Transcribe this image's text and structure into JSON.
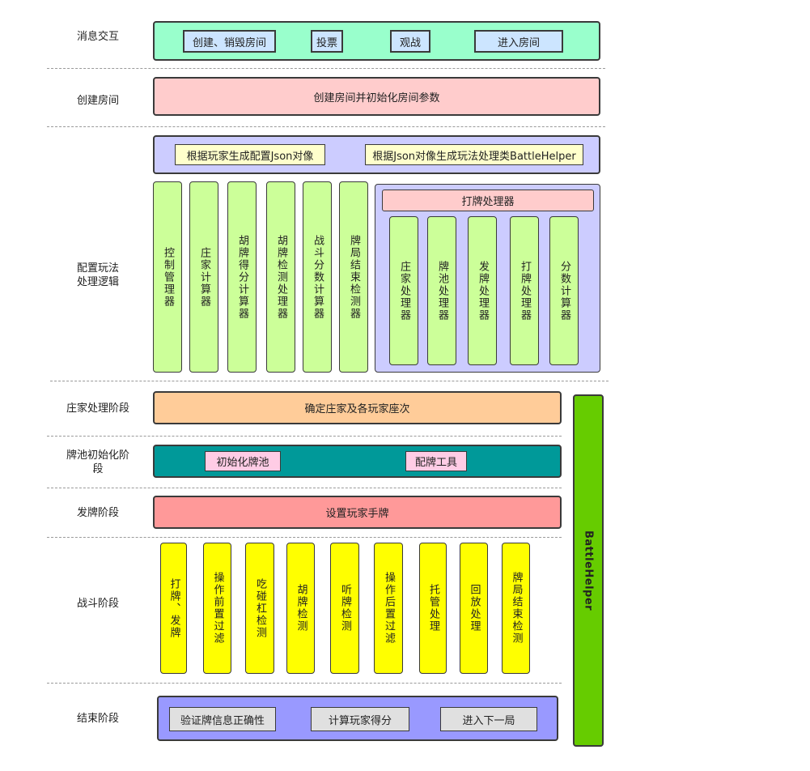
{
  "labels": {
    "message": "消息交互",
    "create_room": "创建房间",
    "config": "配置玩法\n处理逻辑",
    "dealer": "庄家处理阶段",
    "pool": "牌池初始化阶\n段",
    "deal": "发牌阶段",
    "battle": "战斗阶段",
    "end": "结束阶段"
  },
  "message": {
    "items": [
      "创建、销毁房间",
      "投票",
      "观战",
      "进入房间"
    ]
  },
  "create_room": {
    "text": "创建房间并初始化房间参数"
  },
  "config": {
    "top_items": [
      "根据玩家生成配置Json对像",
      "根据Json对像生成玩法处理类BattleHelper"
    ],
    "columns": [
      "控制管理器",
      "庄家计算器",
      "胡牌得分计算器",
      "胡牌检测处理器",
      "战斗分数计算器",
      "牌局结束检测器"
    ],
    "play_handler": {
      "title": "打牌处理器",
      "columns": [
        "庄家处理器",
        "牌池处理器",
        "发牌处理器",
        "打牌处理器",
        "分数计算器"
      ]
    }
  },
  "dealer": {
    "text": "确定庄家及各玩家座次"
  },
  "pool": {
    "items": [
      "初始化牌池",
      "配牌工具"
    ]
  },
  "deal": {
    "text": "设置玩家手牌"
  },
  "battle": {
    "columns": [
      "打牌、发牌",
      "操作前置过滤",
      "吃碰杠检测",
      "胡牌检测",
      "听牌检测",
      "操作后置过滤",
      "托管处理",
      "回放处理",
      "牌局结束检测"
    ]
  },
  "end": {
    "items": [
      "验证牌信息正确性",
      "计算玩家得分",
      "进入下一局"
    ]
  },
  "side": {
    "text": "BattleHelper"
  },
  "colors": {
    "message_bg": "#99ffcc",
    "message_item": "#cce5ff",
    "create_room_bg": "#ffcccc",
    "config_bg": "#ccccff",
    "config_item": "#ffffcc",
    "green_col": "#ccff99",
    "dealer_bg": "#ffcc99",
    "pool_bg": "#009999",
    "pool_item": "#ffcce5",
    "deal_bg": "#ff9999",
    "battle_col": "#ffff00",
    "end_bg": "#9999ff",
    "end_item": "#e0e0e0",
    "side_bg": "#66cc00"
  }
}
